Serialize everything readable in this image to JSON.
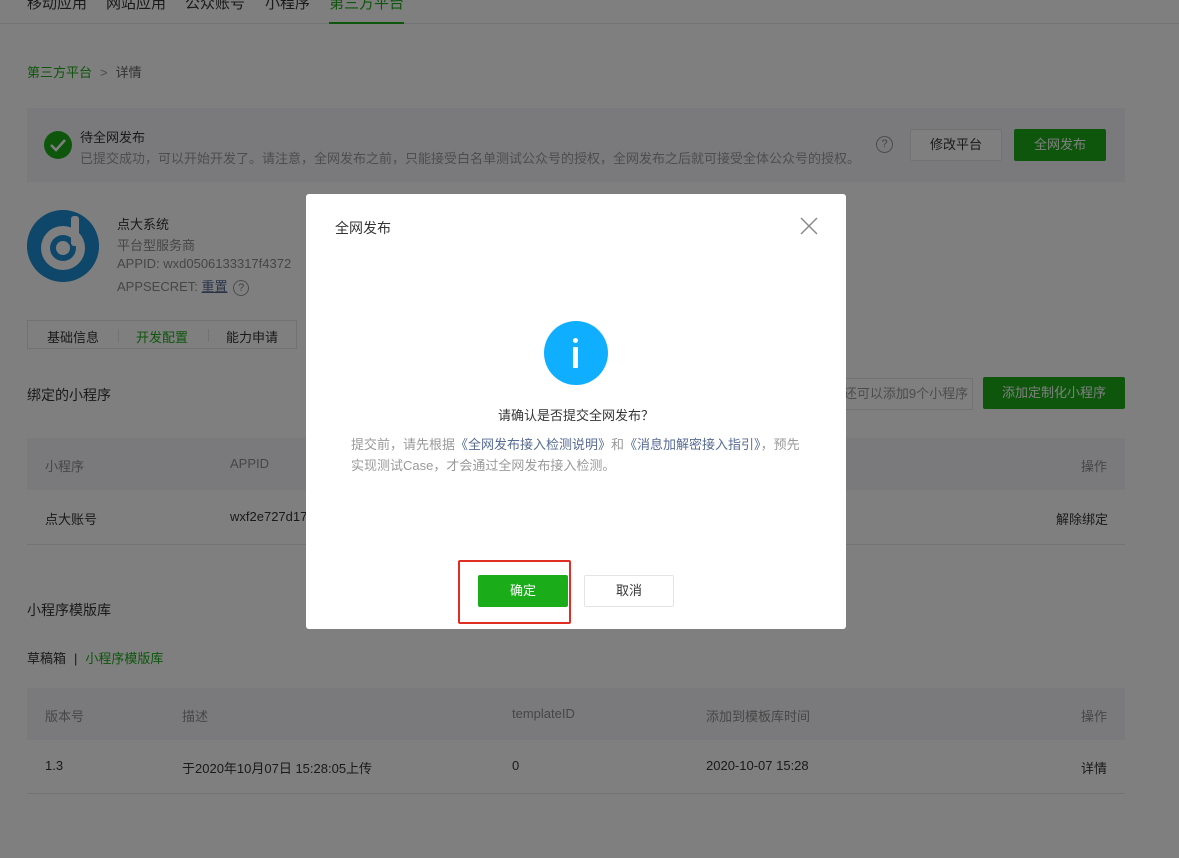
{
  "topnav": {
    "tabs": [
      "移动应用",
      "网站应用",
      "公众账号",
      "小程序",
      "第三方平台"
    ]
  },
  "breadcrumb": {
    "parent": "第三方平台",
    "separator": ">",
    "current": "详情"
  },
  "notice": {
    "title": "待全网发布",
    "desc": "已提交成功，可以开始开发了。请注意，全网发布之前，只能接受白名单测试公众号的授权，全网发布之后就可接受全体公众号的授权。",
    "help": "?",
    "modify_label": "修改平台",
    "publish_label": "全网发布"
  },
  "account": {
    "name": "点大系统",
    "type": "平台型服务商",
    "appid": "APPID: wxd0506133317f4372",
    "secret_label": "APPSECRET: ",
    "reset_label": "重置",
    "help": "?"
  },
  "subtabs": [
    "基础信息",
    "开发配置",
    "能力申请"
  ],
  "bound": {
    "title": "绑定的小程序",
    "hint": "还可以添加9个小程序",
    "add_label": "添加定制化小程序",
    "headers": [
      "小程序",
      "APPID",
      "操作"
    ],
    "rows": [
      {
        "name": "点大账号",
        "appid": "wxf2e727d17",
        "op": "解除绑定"
      }
    ]
  },
  "templates": {
    "title": "小程序模版库",
    "tab_drafts": "草稿箱",
    "tab_sep": "|",
    "tab_lib": "小程序模版库",
    "headers": [
      "版本号",
      "描述",
      "templateID",
      "添加到模板库时间",
      "操作"
    ],
    "rows": [
      {
        "version": "1.3",
        "desc": "于2020年10月07日 15:28:05上传",
        "tid": "0",
        "time": "2020-10-07 15:28",
        "op": "详情"
      }
    ]
  },
  "dialog": {
    "title": "全网发布",
    "question": "请确认是否提交全网发布？",
    "desc_1": "提交前，请先根据",
    "link_1": "《全网发布接入检测说明》",
    "desc_2": "和",
    "link_2": "《消息加解密接入指引》",
    "desc_3": "，预先实现测试Case，才会通过全网发布接入检测。",
    "confirm_label": "确定",
    "cancel_label": "取消"
  },
  "colors": {
    "primary": "#1aad19",
    "info": "#10aeff",
    "link": "#576b95",
    "highlight": "#e02e24"
  }
}
